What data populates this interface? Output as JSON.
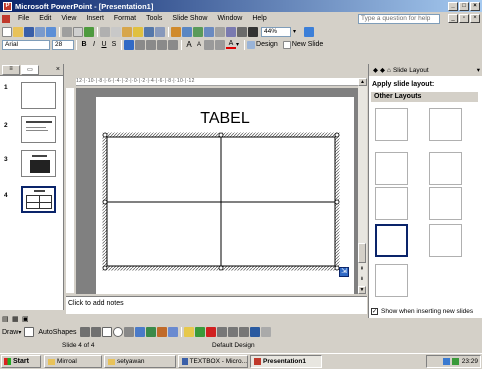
{
  "window": {
    "title": "Microsoft PowerPoint - [Presentation1]"
  },
  "menu": {
    "items": [
      "File",
      "Edit",
      "View",
      "Insert",
      "Format",
      "Tools",
      "Slide Show",
      "Window",
      "Help"
    ],
    "help_placeholder": "Type a question for help"
  },
  "toolbar": {
    "zoom": "44%",
    "font": "Arial",
    "font_size": "28",
    "design_label": "Design",
    "new_slide_label": "New Slide"
  },
  "slides_pane": {
    "slides": [
      {
        "number": "1"
      },
      {
        "number": "2"
      },
      {
        "number": "3"
      },
      {
        "number": "4"
      }
    ]
  },
  "ruler": {
    "top_text": "12·|·10·|·8·|·6·|·4·|·2·|·0·|·2·|·4·|·6·|·8·|·10·|·12"
  },
  "slide": {
    "title": "TABEL",
    "table": {
      "rows": 2,
      "cols": 2
    }
  },
  "notes": {
    "placeholder": "Click to add notes"
  },
  "task_pane": {
    "header": "Slide Layout",
    "apply_label": "Apply slide layout:",
    "section": "Other Layouts",
    "show_label": "Show when inserting new slides"
  },
  "drawbar": {
    "draw_label": "Draw",
    "autoshapes_label": "AutoShapes"
  },
  "status": {
    "slide_info": "Slide 4 of 4",
    "design": "Default Design"
  },
  "taskbar": {
    "start_label": "Start",
    "tasks": [
      "Mirroal",
      "setyawan",
      "TEXTBOX - Micro...",
      "Presentation1"
    ],
    "clock": "23:29"
  },
  "colors": {
    "title_gradient_start": "#0a246a",
    "selection": "#316ac5"
  }
}
